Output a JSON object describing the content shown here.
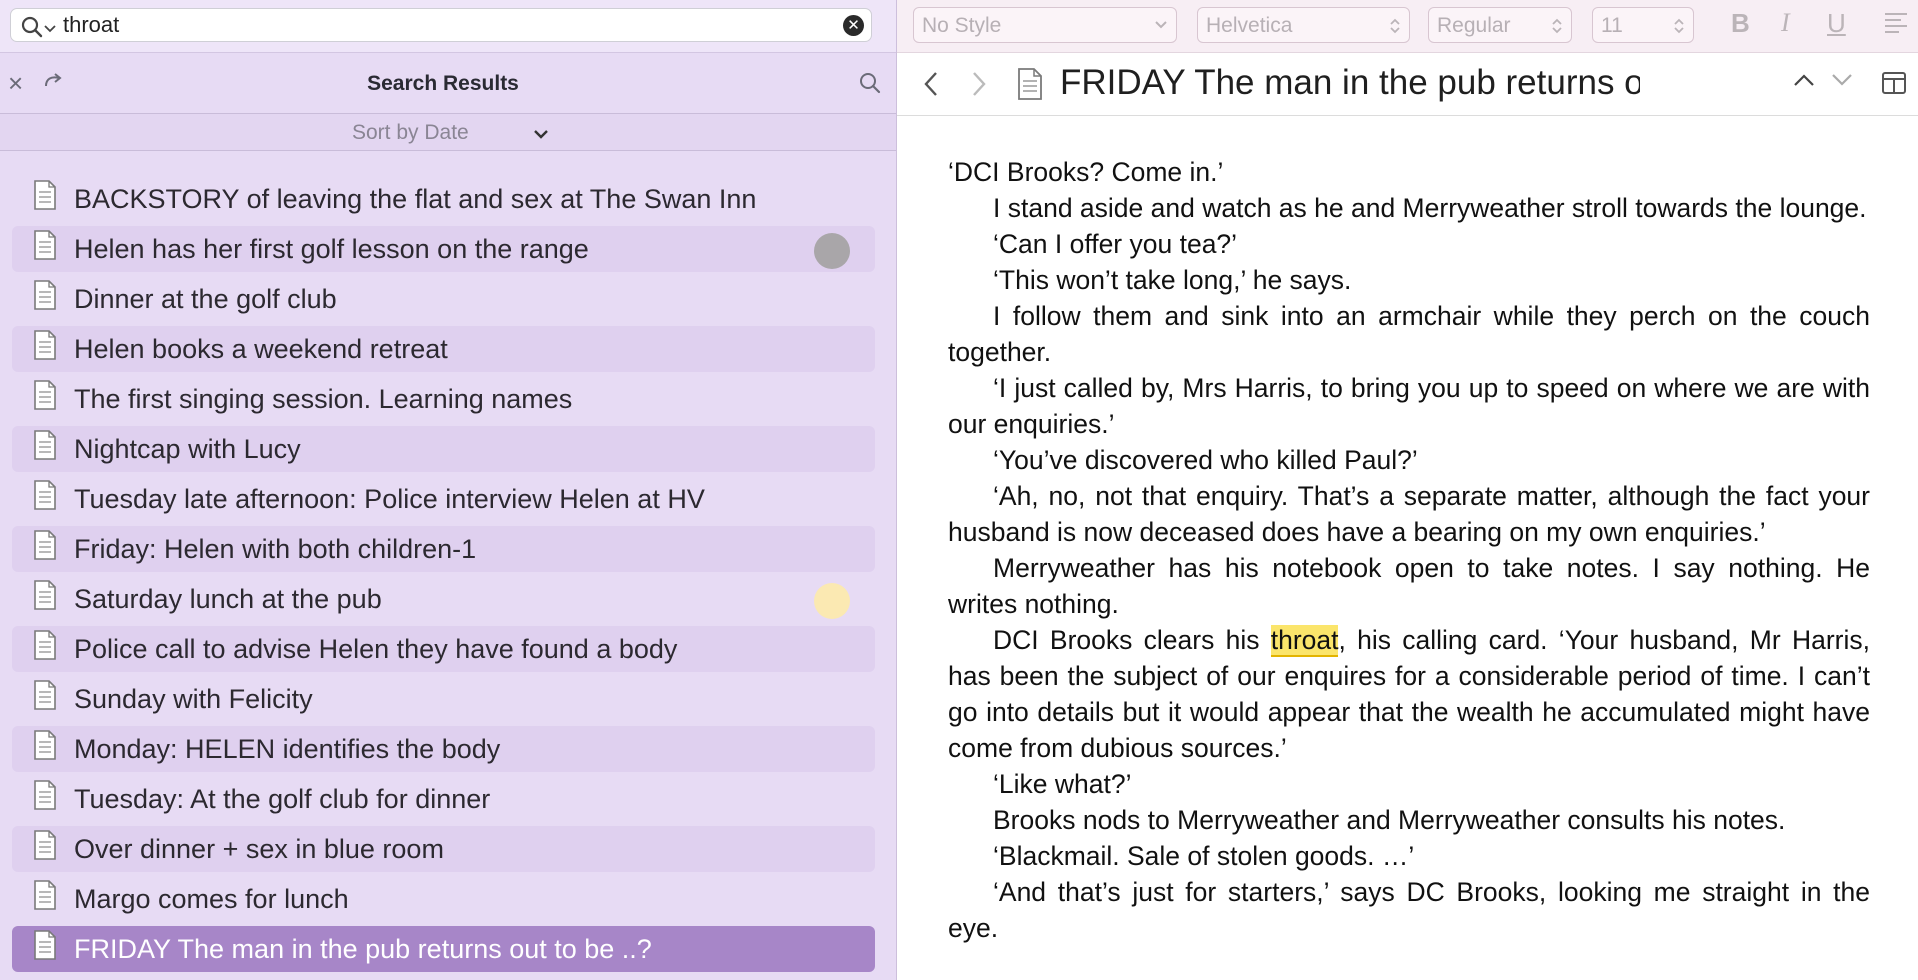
{
  "search": {
    "query": "throat"
  },
  "results_panel": {
    "title": "Search Results",
    "sort_label": "Sort by Date",
    "items": [
      {
        "label": "BACKSTORY of leaving the flat and sex at The Swan Inn"
      },
      {
        "label": "Helen has her first golf lesson on the range",
        "dot_color": "#a9a6a9"
      },
      {
        "label": "Dinner at the golf club"
      },
      {
        "label": "Helen books a weekend retreat"
      },
      {
        "label": "The first singing session. Learning names"
      },
      {
        "label": "Nightcap with Lucy"
      },
      {
        "label": "Tuesday late afternoon: Police interview Helen at HV"
      },
      {
        "label": "Friday: Helen with both children-1"
      },
      {
        "label": "Saturday lunch at the pub",
        "dot_color": "#fbe9b2"
      },
      {
        "label": "Police call to advise Helen they have found a body"
      },
      {
        "label": "Sunday with Felicity"
      },
      {
        "label": "Monday: HELEN identifies the body"
      },
      {
        "label": "Tuesday: At the golf club for dinner"
      },
      {
        "label": "Over dinner + sex in blue room"
      },
      {
        "label": "Margo comes for lunch"
      },
      {
        "label": "FRIDAY The man in the pub returns out to be ..?",
        "selected": true
      }
    ]
  },
  "format_bar": {
    "style": "No Style",
    "font": "Helvetica",
    "weight": "Regular",
    "size": "11",
    "bold": "B",
    "italic": "I",
    "underline": "U"
  },
  "document": {
    "title": "FRIDAY The man in the pub returns out to...",
    "highlight_term": "throat",
    "paragraphs": [
      {
        "text": "‘DCI Brooks? Come in.’"
      },
      {
        "text": "I stand aside and watch as he and Merryweather stroll towards the lounge."
      },
      {
        "text": "‘Can I offer you tea?’"
      },
      {
        "text": "‘This won’t take long,’ he says."
      },
      {
        "text": "I follow them and sink into an armchair while they perch on the couch together."
      },
      {
        "text": "‘I just called by, Mrs Harris, to bring you up to speed on where we are with our enquiries.’"
      },
      {
        "text": "‘You’ve discovered who killed Paul?’"
      },
      {
        "text": "‘Ah, no, not that enquiry. That’s a separate matter, although the fact your husband is now deceased does have a bearing on my own enquiries.’"
      },
      {
        "text": "Merryweather has his notebook open to take notes. I say nothing. He writes nothing."
      },
      {
        "before": "DCI Brooks clears his ",
        "hit": "throat",
        "after": ", his calling card. ‘Your husband, Mr Harris, has been the subject of our enquires for a considerable period of time. I can’t go into details but it would appear that the wealth he accumulated might have come from dubious sources.’"
      },
      {
        "text": "‘Like what?’"
      },
      {
        "text": "Brooks nods to Merryweather and Merryweather consults his notes."
      },
      {
        "text": "‘Blackmail. Sale of stolen goods. …’"
      },
      {
        "text": "‘And that’s just for starters,’ says DC Brooks, looking me straight in the eye."
      }
    ]
  }
}
